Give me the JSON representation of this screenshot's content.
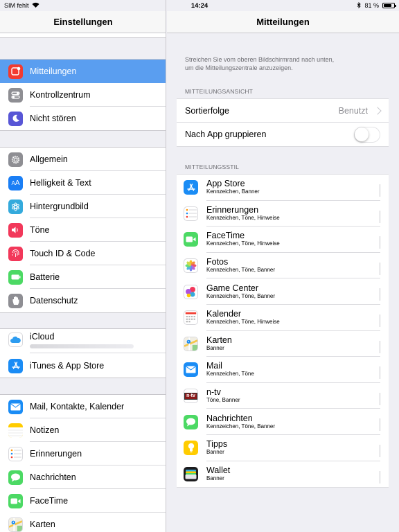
{
  "status": {
    "carrier": "SIM fehlt",
    "time": "14:24",
    "battery": "81 %",
    "battery_level": 0.81
  },
  "sidebar": {
    "title": "Einstellungen",
    "groups": [
      [
        {
          "label": "Mitteilungen",
          "icon": "notifications-icon",
          "color": "#f23b30",
          "selected": true
        },
        {
          "label": "Kontrollzentrum",
          "icon": "control-center-icon",
          "color": "#8e8e93"
        },
        {
          "label": "Nicht stören",
          "icon": "moon-icon",
          "color": "#5856d6"
        }
      ],
      [
        {
          "label": "Allgemein",
          "icon": "gear-icon",
          "color": "#8e8e93"
        },
        {
          "label": "Helligkeit & Text",
          "icon": "brightness-text-icon",
          "color": "#1a7ef5"
        },
        {
          "label": "Hintergrundbild",
          "icon": "wallpaper-icon",
          "color": "#34aadc"
        },
        {
          "label": "Töne",
          "icon": "sounds-icon",
          "color": "#f2385a"
        },
        {
          "label": "Touch ID & Code",
          "icon": "fingerprint-icon",
          "color": "#f2385a"
        },
        {
          "label": "Batterie",
          "icon": "battery-icon",
          "color": "#4cd964"
        },
        {
          "label": "Datenschutz",
          "icon": "hand-icon",
          "color": "#8e8e93"
        }
      ],
      [
        {
          "label": "iCloud",
          "icon": "icloud-icon",
          "color": "#ffffff"
        },
        {
          "label": "iTunes & App Store",
          "icon": "app-store-icon",
          "color": "#1a8cf5"
        }
      ],
      [
        {
          "label": "Mail, Kontakte, Kalender",
          "icon": "mail-icon",
          "color": "#1a8cf5"
        },
        {
          "label": "Notizen",
          "icon": "notes-icon",
          "color": "#ffcc00"
        },
        {
          "label": "Erinnerungen",
          "icon": "reminders-icon",
          "color": "#ffffff"
        },
        {
          "label": "Nachrichten",
          "icon": "messages-icon",
          "color": "#4cd964"
        },
        {
          "label": "FaceTime",
          "icon": "facetime-icon",
          "color": "#4cd964"
        },
        {
          "label": "Karten",
          "icon": "maps-icon",
          "color": "#ffffff"
        }
      ]
    ]
  },
  "detail": {
    "title": "Mitteilungen",
    "description_1": "Streichen Sie vom oberen Bildschirmrand nach unten,",
    "description_2": "um die Mitteilungszentrale anzuzeigen.",
    "section_view": "MITTEILUNGSANSICHT",
    "sort_label": "Sortierfolge",
    "sort_value": "Benutzt",
    "group_label": "Nach App gruppieren",
    "group_on": false,
    "section_style": "MITTEILUNGSSTIL",
    "apps": [
      {
        "name": "App Store",
        "sub": "Kennzeichen, Banner",
        "icon": "app-store-icon",
        "color": "#1a8cf5"
      },
      {
        "name": "Erinnerungen",
        "sub": "Kennzeichen, Töne, Hinweise",
        "icon": "reminders-icon",
        "color": "#ffffff"
      },
      {
        "name": "FaceTime",
        "sub": "Kennzeichen, Töne, Hinweise",
        "icon": "facetime-icon",
        "color": "#4cd964"
      },
      {
        "name": "Fotos",
        "sub": "Kennzeichen, Töne, Banner",
        "icon": "photos-icon",
        "color": "#ffffff"
      },
      {
        "name": "Game Center",
        "sub": "Kennzeichen, Töne, Banner",
        "icon": "game-center-icon",
        "color": "#ffffff"
      },
      {
        "name": "Kalender",
        "sub": "Kennzeichen, Töne, Hinweise",
        "icon": "calendar-icon",
        "color": "#ffffff"
      },
      {
        "name": "Karten",
        "sub": "Banner",
        "icon": "maps-icon",
        "color": "#ffffff"
      },
      {
        "name": "Mail",
        "sub": "Kennzeichen, Töne",
        "icon": "mail-icon",
        "color": "#1a8cf5"
      },
      {
        "name": "n-tv",
        "sub": "Töne, Banner",
        "icon": "ntv-icon",
        "color": "#ffffff"
      },
      {
        "name": "Nachrichten",
        "sub": "Kennzeichen, Töne, Banner",
        "icon": "messages-icon",
        "color": "#4cd964"
      },
      {
        "name": "Tipps",
        "sub": "Banner",
        "icon": "tips-icon",
        "color": "#ffcc00"
      },
      {
        "name": "Wallet",
        "sub": "Banner",
        "icon": "wallet-icon",
        "color": "#1c1c1e"
      }
    ]
  }
}
